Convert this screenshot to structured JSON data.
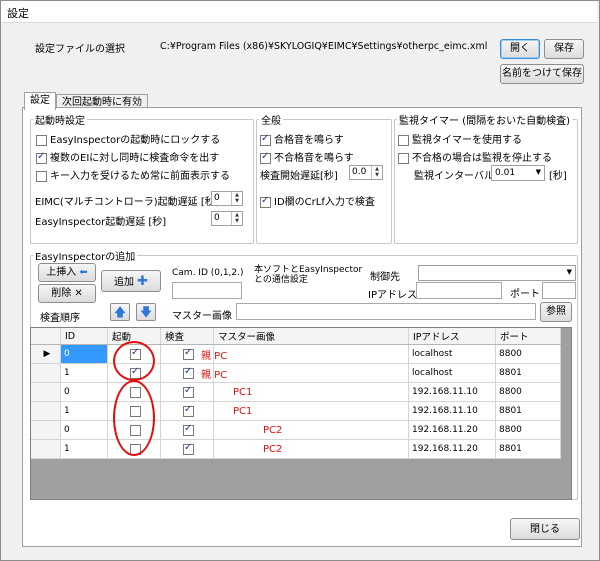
{
  "window": {
    "title": "設定"
  },
  "settings_file": {
    "label": "設定ファイルの選択",
    "path": "C:¥Program Files (x86)¥SKYLOGIQ¥EIMC¥Settings¥otherpc_eimc.xml",
    "open_label": "開く",
    "save_label": "保存",
    "save_as_label": "名前をつけて保存"
  },
  "tabs": [
    {
      "label": "設定"
    },
    {
      "label": "次回起動時に有効"
    }
  ],
  "startup": {
    "title": "起動時設定",
    "lock_label": "EasyInspectorの起動時にロックする",
    "lock": false,
    "simultaneous_label": "複数のEIに対し同時に検査命令を出す",
    "simultaneous": true,
    "foreground_label": "キー入力を受けるため常に前面表示する",
    "foreground": false,
    "eimc_delay_label": "EIMC(マルチコントローラ)起動遅延 [秒]",
    "eimc_delay": "0",
    "ei_delay_label": "EasyInspector起動遅延 [秒]",
    "ei_delay": "0"
  },
  "general": {
    "title": "全般",
    "pass_sound_label": "合格音を鳴らす",
    "pass_sound": true,
    "fail_sound_label": "不合格音を鳴らす",
    "fail_sound": true,
    "inspect_delay_label": "検査開始遅延[秒]",
    "inspect_delay": "0.0",
    "crlf_label": "ID欄のCrLf入力で検査",
    "crlf": true
  },
  "timer": {
    "title": "監視タイマー (間隔をおいた自動検査)",
    "use_label": "監視タイマーを使用する",
    "use": false,
    "stop_label": "不合格の場合は監視を停止する",
    "stop": false,
    "interval_label": "監視インターバル",
    "interval": "0.01",
    "interval_unit": "[秒]"
  },
  "add": {
    "title": "EasyInspectorの追加",
    "insert_up_label": "上挿入",
    "delete_label": "削除",
    "order_label": "検査順序",
    "add_label": "追加",
    "cam_id_label": "Cam. ID (0,1,2.)",
    "comm_label_1": "本ソフトとEasyInspector",
    "comm_label_2": "との通信設定",
    "control_label": "制御先",
    "ip_label": "IPアドレス",
    "port_label": "ポート",
    "master_label": "マスター画像",
    "browse_label": "参照"
  },
  "grid": {
    "columns": [
      "ID",
      "起動",
      "検査",
      "マスター画像",
      "IPアドレス",
      "ポート"
    ],
    "rows": [
      {
        "id": "0",
        "start": true,
        "check": true,
        "master": "親 PC",
        "ip": "localhost",
        "port": "8800",
        "current": true
      },
      {
        "id": "1",
        "start": true,
        "check": true,
        "master": "親 PC",
        "ip": "localhost",
        "port": "8801",
        "current": false
      },
      {
        "id": "0",
        "start": false,
        "check": true,
        "master": "PC1",
        "ip": "192.168.11.10",
        "port": "8800",
        "current": false
      },
      {
        "id": "1",
        "start": false,
        "check": true,
        "master": "PC1",
        "ip": "192.168.11.10",
        "port": "8801",
        "current": false
      },
      {
        "id": "0",
        "start": false,
        "check": true,
        "master": "PC2",
        "ip": "192.168.11.20",
        "port": "8800",
        "current": false
      },
      {
        "id": "1",
        "start": false,
        "check": true,
        "master": "PC2",
        "ip": "192.168.11.20",
        "port": "8801",
        "current": false
      }
    ]
  },
  "close_label": "閉じる",
  "colors": {
    "annotation": "#e01010",
    "selection": "#3399ff"
  }
}
